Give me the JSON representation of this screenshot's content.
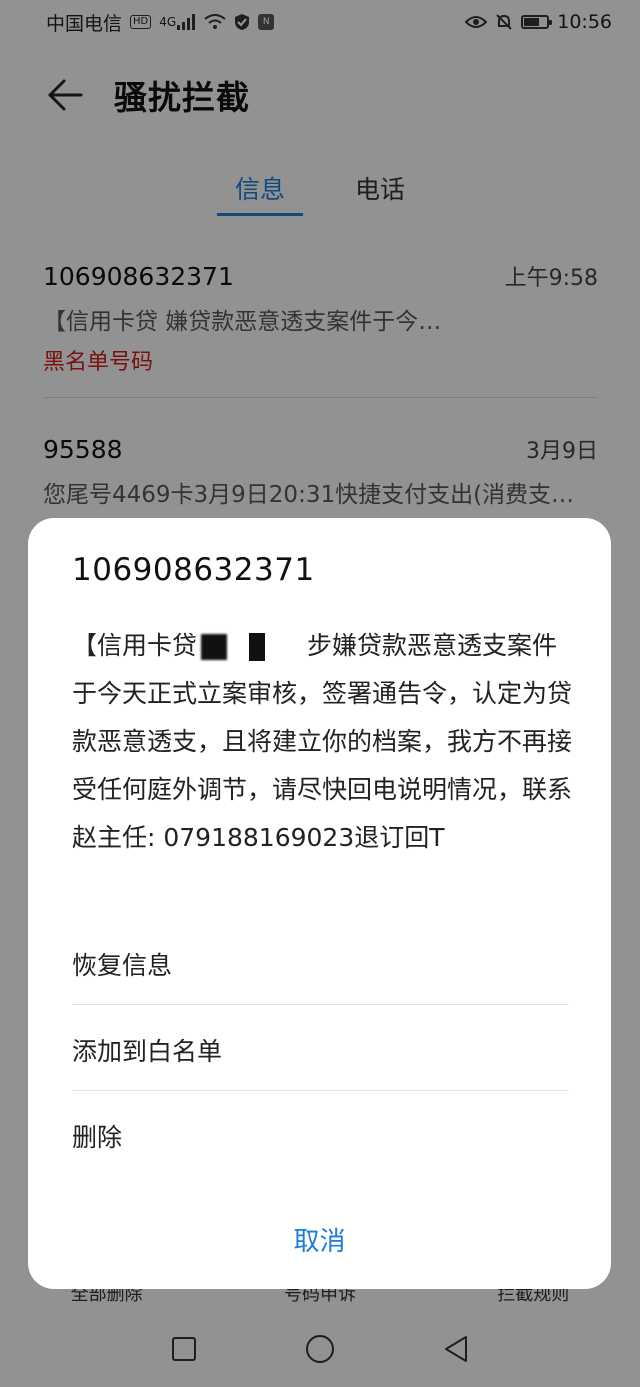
{
  "status_bar": {
    "carrier": "中国电信",
    "hd": "HD",
    "network": "4G",
    "nfc": "N",
    "time": "10:56"
  },
  "header": {
    "title": "骚扰拦截"
  },
  "tabs": [
    {
      "label": "信息",
      "active": true
    },
    {
      "label": "电话",
      "active": false
    }
  ],
  "messages": [
    {
      "sender": "106908632371",
      "time": "上午9:58",
      "preview": "【信用卡贷    嫌贷款恶意透支案件于今…",
      "tag": "黑名单号码"
    },
    {
      "sender": "95588",
      "time": "3月9日",
      "preview": "您尾号4469卡3月9日20:31快捷支付支出(消费支…"
    }
  ],
  "bottom_actions": [
    "全部删除",
    "号码申诉",
    "拦截规则"
  ],
  "dialog": {
    "number": "106908632371",
    "body_prefix": "【信用卡贷",
    "body_rest": "步嫌贷款恶意透支案件于今天正式立案审核，签署通告令，认定为贷款恶意透支，且将建立你的档案，我方不再接受任何庭外调节，请尽快回电说明情况，联系赵主任: 079188169023退订回T",
    "options": [
      "恢复信息",
      "添加到白名单",
      "删除"
    ],
    "cancel": "取消"
  },
  "colors": {
    "accent": "#1a7dd6",
    "blacklist": "#cc1b1b"
  }
}
